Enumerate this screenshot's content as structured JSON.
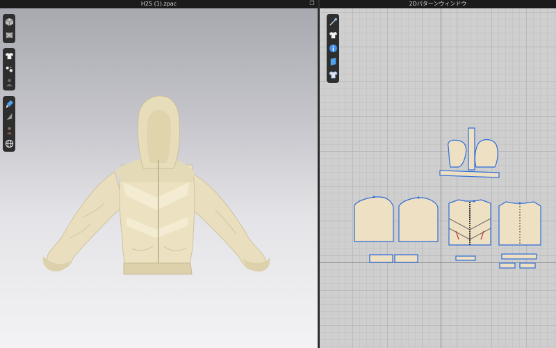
{
  "left_window": {
    "title": "H25 (1).zpac",
    "restore_icon": "restore-window-icon"
  },
  "right_window": {
    "title": "2Dパターンウィンドウ"
  },
  "toolbar3d": {
    "groups": [
      [
        "view-cube-icon",
        "avatar-texture-icon"
      ],
      [
        "garment-shirt-icon",
        "fabric-dots-icon",
        "avatar-person-icon"
      ],
      [
        "brush-icon",
        "paint-triangle-icon",
        "figure-icon",
        "globe-icon"
      ]
    ]
  },
  "toolbar2d": {
    "items": [
      "needle-icon",
      "shirt-icon",
      "info-icon",
      "layer-icon",
      "shirt-outline-icon"
    ]
  },
  "colors": {
    "fabric": "#efe5c6",
    "fabric_shade": "#d8cca6",
    "pattern_fill": "#eee1c3",
    "pattern_outline": "#2d6bd8",
    "toolbar_bg": "#2e2e2e"
  }
}
